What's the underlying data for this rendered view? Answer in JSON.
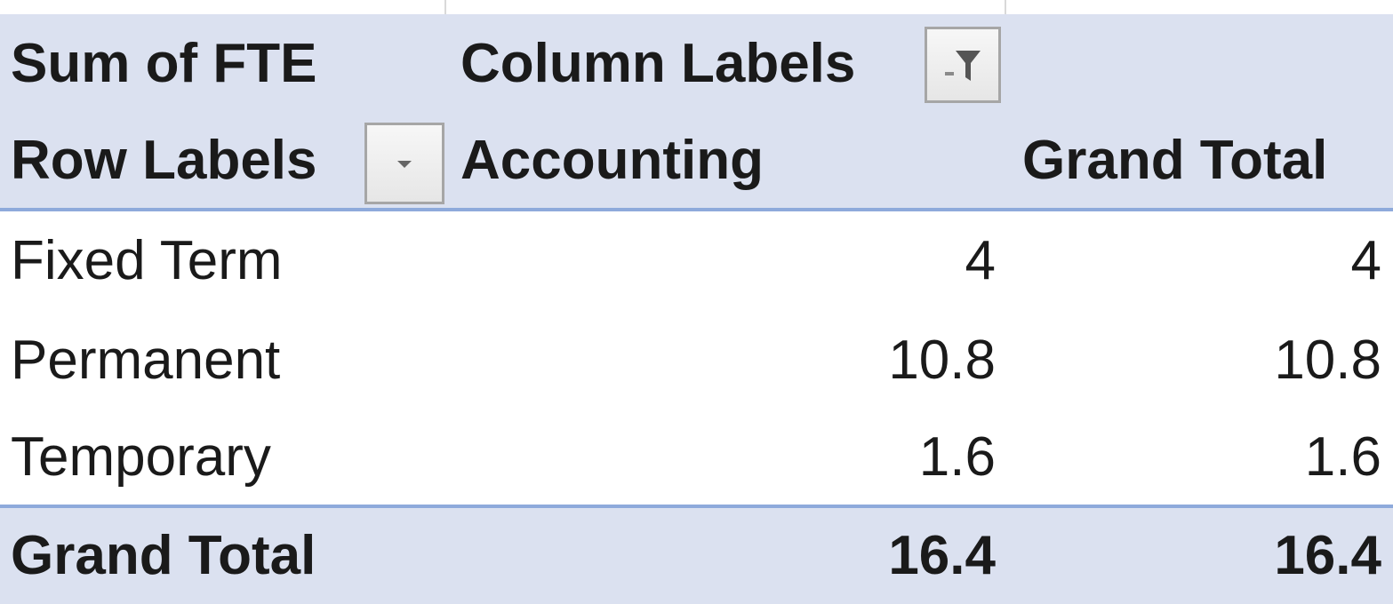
{
  "pivot": {
    "header1": {
      "value_field": "Sum of FTE",
      "column_labels": "Column Labels"
    },
    "header2": {
      "row_labels": "Row Labels",
      "column_item": "Accounting",
      "grand_total": "Grand Total"
    },
    "rows": [
      {
        "label": "Fixed Term",
        "accounting": "4",
        "total": "4"
      },
      {
        "label": "Permanent",
        "accounting": "10.8",
        "total": "10.8"
      },
      {
        "label": "Temporary",
        "accounting": "1.6",
        "total": "1.6"
      }
    ],
    "footer": {
      "label": "Grand Total",
      "accounting": "16.4",
      "total": "16.4"
    },
    "icons": {
      "column_filter": "filter-applied-icon",
      "row_filter": "dropdown-arrow-icon"
    },
    "colors": {
      "header_fill": "#dbe1f0",
      "separator": "#8eaadb"
    }
  }
}
